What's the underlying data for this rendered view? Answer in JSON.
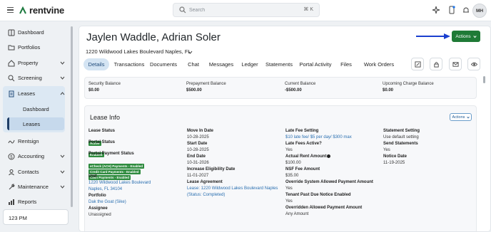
{
  "brand": {
    "name": "rentvine"
  },
  "search": {
    "placeholder": "Search",
    "shortcut": "⌘ K"
  },
  "user": {
    "initials": "MH"
  },
  "sidebar": {
    "items": [
      {
        "label": "Dashboard",
        "icon": "dashboard-icon"
      },
      {
        "label": "Portfolios",
        "icon": "folder-icon"
      },
      {
        "label": "Property",
        "icon": "home-icon"
      },
      {
        "label": "Screening",
        "icon": "screening-icon"
      },
      {
        "label": "Leases",
        "icon": "document-icon"
      },
      {
        "label": "Rentsign",
        "icon": "signature-icon"
      },
      {
        "label": "Accounting",
        "icon": "dollar-icon"
      },
      {
        "label": "Contacts",
        "icon": "contacts-icon"
      },
      {
        "label": "Maintenance",
        "icon": "wrench-icon"
      },
      {
        "label": "Reports",
        "icon": "reports-icon"
      }
    ],
    "lease_subitems": [
      "Dashboard",
      "Leases"
    ],
    "bottom_text": "123 PM"
  },
  "header": {
    "tenant_name": "Jaylen Waddle, Adrian Soler",
    "address": "1220 Wildwood Lakes Boulevard Naples, FL",
    "actions_label": "Actions"
  },
  "tabs": [
    "Details",
    "Transactions",
    "Documents",
    "Chat",
    "Messages",
    "Ledger",
    "Statements",
    "Portal Activity",
    "Files",
    "Work Orders"
  ],
  "balances": [
    {
      "label": "Security Balance",
      "value": "$0.00"
    },
    {
      "label": "Prepayment Balance",
      "value": "$500.00"
    },
    {
      "label": "Current Balance",
      "value": "-$500.00"
    },
    {
      "label": "Upcoming Charge Balance",
      "value": "$0.00"
    }
  ],
  "lease_info": {
    "title": "Lease Info",
    "actions_label": "Actions",
    "col1": {
      "lease_status_label": "Lease Status",
      "lease_status_badge": "Active",
      "portal_status_label": "Portal Status",
      "portal_status_badge": "Enabled",
      "portal_payment_label": "Portal Payment Status",
      "payment_badges": [
        "eCheck (ACH) Payments - Enabled",
        "Credit Card Payments - Enabled",
        "Cash Payments - Enabled"
      ],
      "unit_label": "Unit",
      "unit_line1": "1220 Wildwood Lakes Boulevard",
      "unit_line2": "Naples, FL 34104",
      "portfolio_label": "Portfolio",
      "portfolio_value": "Dak the Goat (Sike)",
      "assignee_label": "Assignee",
      "assignee_value": "Unassigned"
    },
    "col2": {
      "move_in_label": "Move In Date",
      "move_in_value": "10-28-2025",
      "start_label": "Start Date",
      "start_value": "10-28-2025",
      "end_label": "End Date",
      "end_value": "10-31-2026",
      "eligibility_label": "Increase Eligibility Date",
      "eligibility_value": "11-01-2027",
      "agreement_label": "Lease Agreement",
      "agreement_value": "Lease: 1220 Wildwood Lakes Boulevard Naples",
      "agreement_status": "(Status: Completed)"
    },
    "col3": {
      "late_fee_label": "Late Fee Setting",
      "late_fee_value": "$10 late fee/ $5 per day/ $300 max",
      "late_active_label": "Late Fees Active?",
      "late_active_value": "Yes",
      "actual_rent_label": "Actual Rent Amount",
      "actual_rent_value": "$100.00",
      "nsf_label": "NSF Fee Amount",
      "nsf_value": "$35.00",
      "override_label": "Override System Allowed Payment Amount",
      "override_value": "Yes",
      "tenant_past_due_label": "Tenant Past Due Notice Enabled",
      "tenant_past_due_value": "Yes",
      "overridden_label": "Overridden Allowed Payment Amount",
      "overridden_value": "Any Amount"
    },
    "col4": {
      "statement_label": "Statement Setting",
      "statement_value": "Use default setting",
      "send_label": "Send Statements",
      "send_value": "Yes",
      "notice_label": "Notice Date",
      "notice_value": "11-19-2025"
    }
  },
  "colors": {
    "accent_green": "#1f7a36",
    "badge_green": "#2e8b3e",
    "link_blue": "#2a6fb0",
    "arrow_blue": "#1a3fcf"
  }
}
